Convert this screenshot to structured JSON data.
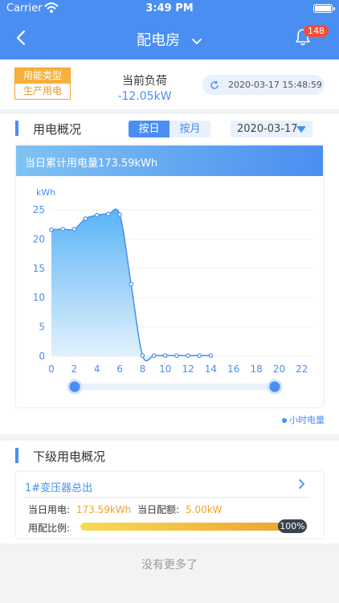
{
  "status_bar": {
    "carrier": "Carrier",
    "time": "3:49 PM"
  },
  "nav": {
    "title": "配电房",
    "badge_count": "148"
  },
  "summary": {
    "energy_type_label": "用能类型",
    "energy_type_value": "生产用电",
    "load_label": "当前负荷",
    "load_value": "-12.05kW",
    "timestamp": "2020-03-17 15:48:59"
  },
  "overview": {
    "title": "用电概况",
    "tabs": [
      {
        "label": "按日",
        "active": true
      },
      {
        "label": "按月",
        "active": false
      }
    ],
    "date": "2020-03-17",
    "card_header": "当日累计用电量173.59kWh",
    "legend": "小时电量",
    "slider": {
      "start": 0,
      "end": 1
    }
  },
  "chart_data": {
    "type": "area",
    "ylabel": "kWh",
    "xlabel": "",
    "x": [
      0,
      1,
      2,
      3,
      4,
      5,
      6,
      7,
      8,
      9,
      10,
      11,
      12,
      13,
      14
    ],
    "values": [
      21.6,
      21.7,
      21.7,
      23.5,
      24.1,
      24.3,
      24.2,
      12.3,
      0.1,
      0.1,
      0.1,
      0.1,
      0.1,
      0.1,
      0.1
    ],
    "x_ticks": [
      "0",
      "2",
      "4",
      "6",
      "8",
      "10",
      "12",
      "14",
      "16",
      "18",
      "20",
      "22"
    ],
    "y_ticks": [
      "0",
      "5",
      "10",
      "15",
      "20",
      "25"
    ],
    "xlim": [
      0,
      23
    ],
    "ylim": [
      0,
      25
    ],
    "grid": true,
    "colors": {
      "line": "#4a8ef2",
      "area_top": "#5ab4f5",
      "area_bottom": "#e6f3fd"
    }
  },
  "sub_overview": {
    "title": "下级用电概况",
    "item": {
      "name": "1#变压器总出",
      "usage_label": "当日用电:",
      "usage_value": "173.59kWh",
      "quota_label": "当日配额:",
      "quota_value": "5.00kW",
      "ratio_label": "用配比例:",
      "ratio_value": "100%",
      "ratio_fraction": 1.0
    }
  },
  "footer": {
    "no_more": "没有更多了"
  },
  "icons": {
    "back": "chevron-left-icon",
    "dropdown": "chevron-down-icon",
    "bell": "bell-icon",
    "refresh": "refresh-icon",
    "calendar_dropdown": "triangle-down-icon",
    "item_arrow": "chevron-right-icon",
    "wifi": "wifi-icon",
    "battery": "battery-icon"
  }
}
